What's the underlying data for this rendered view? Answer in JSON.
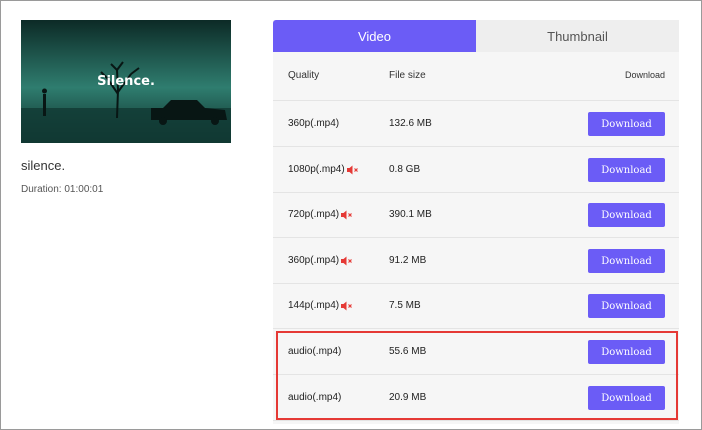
{
  "video": {
    "thumbnail_text": "Silence.",
    "title": "silence.",
    "duration": "Duration: 01:00:01"
  },
  "tabs": [
    {
      "label": "Video",
      "active": true
    },
    {
      "label": "Thumbnail",
      "active": false
    }
  ],
  "table": {
    "headers": {
      "quality": "Quality",
      "file_size": "File size",
      "download": "Download"
    },
    "rows": [
      {
        "quality": "360p(.mp4)",
        "size": "132.6 MB",
        "muted": false,
        "button": "Download"
      },
      {
        "quality": "1080p(.mp4)",
        "size": "0.8 GB",
        "muted": true,
        "button": "Download"
      },
      {
        "quality": "720p(.mp4)",
        "size": "390.1 MB",
        "muted": true,
        "button": "Download"
      },
      {
        "quality": "360p(.mp4)",
        "size": "91.2 MB",
        "muted": true,
        "button": "Download"
      },
      {
        "quality": "144p(.mp4)",
        "size": "7.5 MB",
        "muted": true,
        "button": "Download"
      },
      {
        "quality": "audio(.mp4)",
        "size": "55.6 MB",
        "muted": false,
        "button": "Download"
      },
      {
        "quality": "audio(.mp4)",
        "size": "20.9 MB",
        "muted": false,
        "button": "Download"
      }
    ]
  },
  "colors": {
    "accent": "#6b5cf6",
    "muted_icon": "#e53935",
    "highlight_border": "#e53935"
  },
  "icons": {
    "muted": "speaker-muted-icon"
  }
}
